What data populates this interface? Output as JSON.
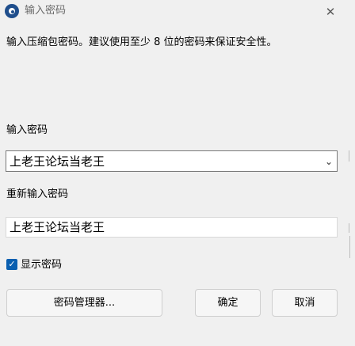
{
  "window": {
    "title": "输入密码",
    "close_symbol": "✕",
    "app_icon": "archive-app-icon"
  },
  "description": "输入压缩包密码。建议使用至少 8 位的密码来保证安全性。",
  "password": {
    "label": "输入密码",
    "value": "上老王论坛当老王",
    "dropdown_icon": "chevron-down-icon"
  },
  "confirm": {
    "label": "重新输入密码",
    "value": "上老王论坛当老王"
  },
  "show_password": {
    "label": "显示密码",
    "checked": true,
    "check_symbol": "✓"
  },
  "buttons": {
    "manager_label": "密码管理器...",
    "ok_label": "确定",
    "cancel_label": "取消"
  },
  "colors": {
    "background": "#f0f0f0",
    "accent": "#0a5fb0"
  }
}
